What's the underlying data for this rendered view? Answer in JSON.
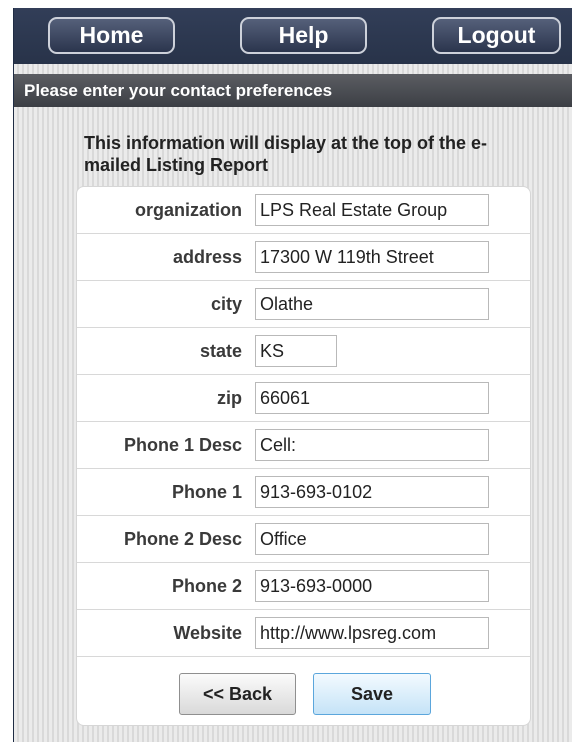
{
  "nav": {
    "home": "Home",
    "help": "Help",
    "logout": "Logout"
  },
  "subheader": "Please enter your contact preferences",
  "intro": "This information will display at the top of the e-mailed Listing Report",
  "form": {
    "organization": {
      "label": "organization",
      "value": "LPS Real Estate Group"
    },
    "address": {
      "label": "address",
      "value": "17300 W 119th Street"
    },
    "city": {
      "label": "city",
      "value": "Olathe"
    },
    "state": {
      "label": "state",
      "value": "KS"
    },
    "zip": {
      "label": "zip",
      "value": "66061"
    },
    "phone1_desc": {
      "label": "Phone 1 Desc",
      "value": "Cell:"
    },
    "phone1": {
      "label": "Phone 1",
      "value": "913-693-0102"
    },
    "phone2_desc": {
      "label": "Phone 2 Desc",
      "value": "Office"
    },
    "phone2": {
      "label": "Phone 2",
      "value": "913-693-0000"
    },
    "website": {
      "label": "Website",
      "value": "http://www.lpsreg.com"
    }
  },
  "buttons": {
    "back": "<< Back",
    "save": "Save"
  },
  "colors": {
    "nav_bg": "#2e3a52",
    "subbar_bg": "#4a4d53",
    "save_border": "#5ba6dc"
  }
}
